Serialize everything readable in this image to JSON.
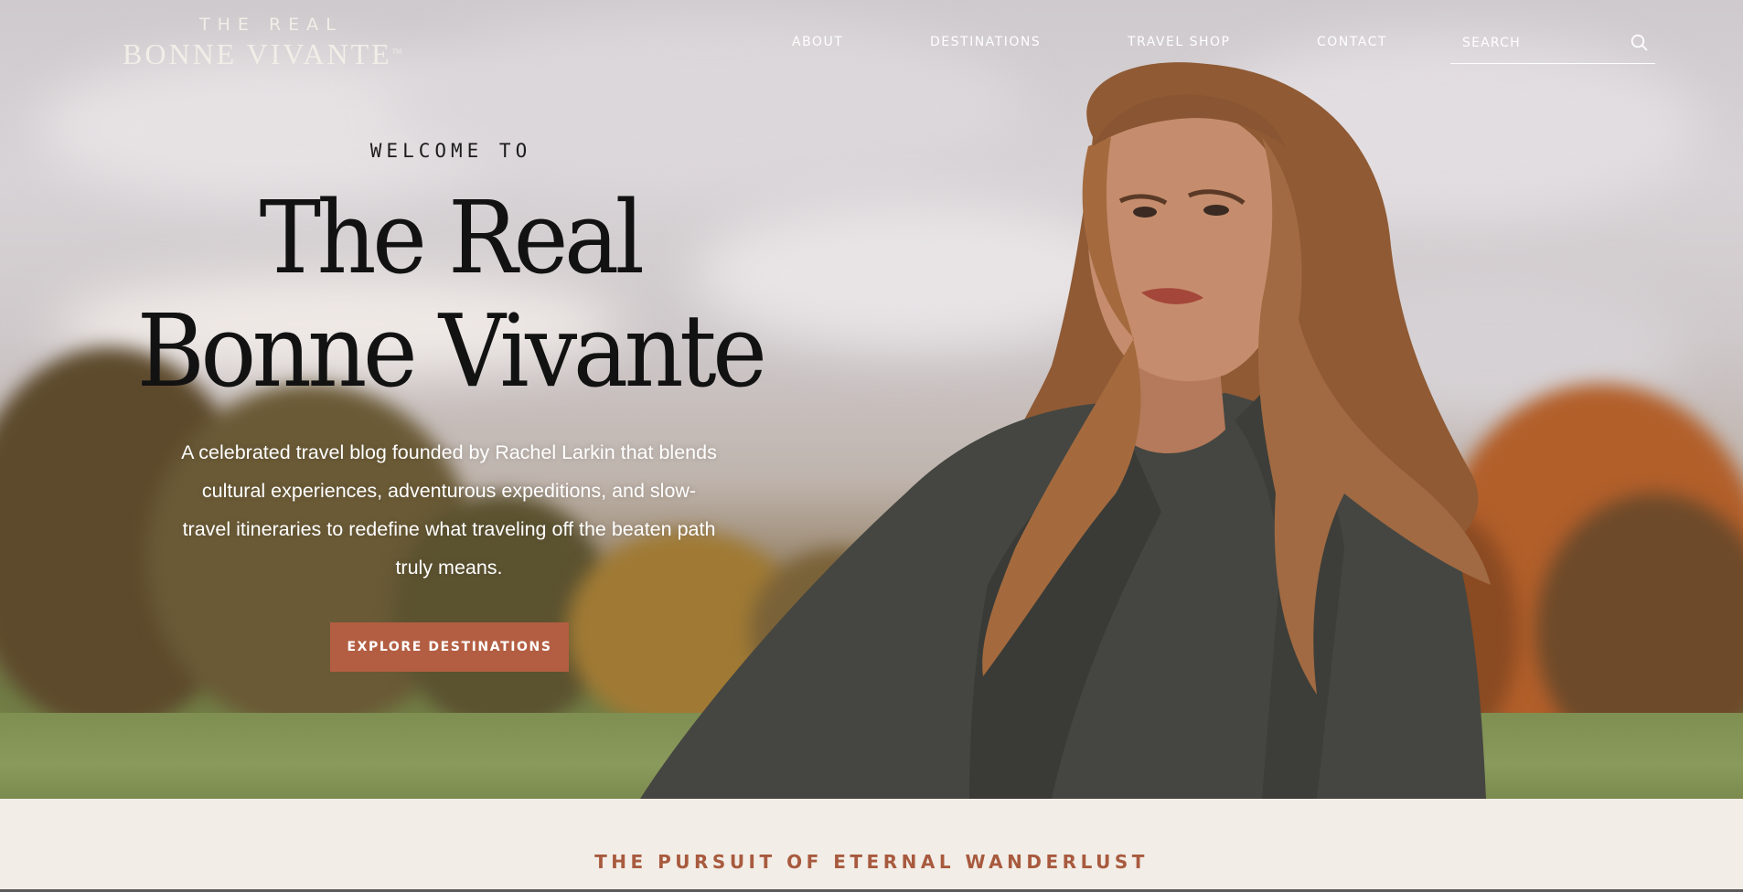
{
  "logo": {
    "top": "THE REAL",
    "main": "BONNE VIVANTE",
    "tm": "TM"
  },
  "nav": {
    "items": [
      {
        "label": "ABOUT"
      },
      {
        "label": "DESTINATIONS"
      },
      {
        "label": "TRAVEL SHOP"
      },
      {
        "label": "CONTACT"
      }
    ]
  },
  "search": {
    "placeholder": "SEARCH",
    "icon": "search-icon"
  },
  "hero": {
    "eyebrow": "WELCOME TO",
    "title_line1": "The Real",
    "title_line2": "Bonne Vivante",
    "description": "A celebrated travel blog founded by Rachel Larkin that blends cultural experiences, adventurous expeditions, and slow-travel itineraries to redefine what traveling off the beaten path truly means.",
    "cta_label": "EXPLORE DESTINATIONS"
  },
  "band": {
    "tagline": "THE PURSUIT OF ETERNAL WANDERLUST"
  },
  "colors": {
    "accent": "#b35e42",
    "tagline": "#a85a3e",
    "band_bg": "#f2ede6",
    "title": "#121212"
  }
}
